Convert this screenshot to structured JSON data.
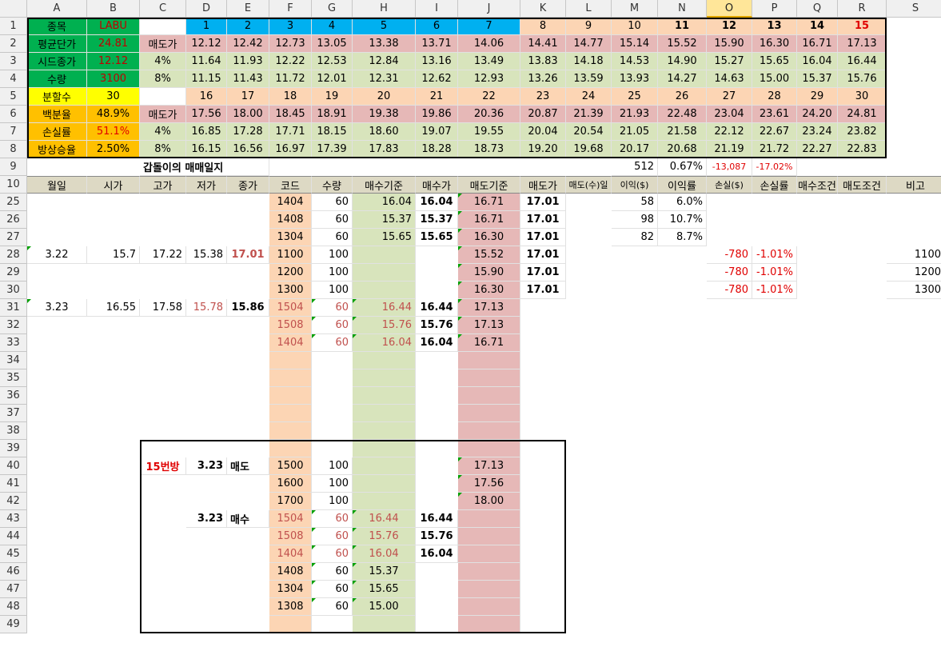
{
  "columns": [
    "A",
    "B",
    "C",
    "D",
    "E",
    "F",
    "G",
    "H",
    "I",
    "J",
    "K",
    "L",
    "M",
    "N",
    "O",
    "P",
    "Q",
    "R",
    "S"
  ],
  "selected_column": "O",
  "rows": [
    "1",
    "2",
    "3",
    "4",
    "5",
    "6",
    "7",
    "8",
    "9",
    "10",
    "25",
    "26",
    "27",
    "28",
    "29",
    "30",
    "31",
    "32",
    "33",
    "34",
    "35",
    "36",
    "37",
    "38",
    "39",
    "40",
    "41",
    "42",
    "43",
    "44",
    "45",
    "46",
    "47",
    "48",
    "49"
  ],
  "colors": {
    "green": "#00b050",
    "yellow": "#ffff00",
    "orange": "#ffc000",
    "blue": "#00b0f0",
    "peach": "#fcd5b4",
    "pink": "#e6b8b7",
    "lightgreen": "#d8e4bc",
    "header": "#ddd9c4"
  },
  "top": {
    "r1": {
      "a": "종목",
      "b": "LABU",
      "nums": [
        "1",
        "2",
        "3",
        "4",
        "5",
        "6",
        "7",
        "8",
        "9",
        "10",
        "11",
        "12",
        "13",
        "14",
        "15"
      ]
    },
    "r2": {
      "a": "평균단가",
      "b": "24.81",
      "c": "매도가",
      "vals": [
        "12.12",
        "12.42",
        "12.73",
        "13.05",
        "13.38",
        "13.71",
        "14.06",
        "14.41",
        "14.77",
        "15.14",
        "15.52",
        "15.90",
        "16.30",
        "16.71",
        "17.13"
      ]
    },
    "r3": {
      "a": "시드종가",
      "b": "12.12",
      "c": "4%",
      "vals": [
        "11.64",
        "11.93",
        "12.22",
        "12.53",
        "12.84",
        "13.16",
        "13.49",
        "13.83",
        "14.18",
        "14.53",
        "14.90",
        "15.27",
        "15.65",
        "16.04",
        "16.44"
      ]
    },
    "r4": {
      "a": "수량",
      "b": "3100",
      "c": "8%",
      "vals": [
        "11.15",
        "11.43",
        "11.72",
        "12.01",
        "12.31",
        "12.62",
        "12.93",
        "13.26",
        "13.59",
        "13.93",
        "14.27",
        "14.63",
        "15.00",
        "15.37",
        "15.76"
      ]
    },
    "r5": {
      "a": "분할수",
      "b": "30",
      "nums": [
        "16",
        "17",
        "18",
        "19",
        "20",
        "21",
        "22",
        "23",
        "24",
        "25",
        "26",
        "27",
        "28",
        "29",
        "30"
      ]
    },
    "r6": {
      "a": "백분율",
      "b": "48.9%",
      "c": "매도가",
      "vals": [
        "17.56",
        "18.00",
        "18.45",
        "18.91",
        "19.38",
        "19.86",
        "20.36",
        "20.87",
        "21.39",
        "21.93",
        "22.48",
        "23.04",
        "23.61",
        "24.20",
        "24.81"
      ]
    },
    "r7": {
      "a": "손실률",
      "b": "51.1%",
      "c": "4%",
      "vals": [
        "16.85",
        "17.28",
        "17.71",
        "18.15",
        "18.60",
        "19.07",
        "19.55",
        "20.04",
        "20.54",
        "21.05",
        "21.58",
        "22.12",
        "22.67",
        "23.24",
        "23.82"
      ]
    },
    "r8": {
      "a": "방상승율",
      "b": "2.50%",
      "c": "8%",
      "vals": [
        "16.15",
        "16.56",
        "16.97",
        "17.39",
        "17.83",
        "18.28",
        "18.73",
        "19.20",
        "19.68",
        "20.17",
        "20.68",
        "21.19",
        "21.72",
        "22.27",
        "22.83"
      ]
    },
    "r9": {
      "title": "갑돌이의 매매일지",
      "m": "512",
      "n": "0.67%",
      "o": "-13,087",
      "p": "-17.02%"
    }
  },
  "headers": [
    "월일",
    "시가",
    "고가",
    "저가",
    "종가",
    "코드",
    "수량",
    "매수기준",
    "매수가",
    "매도기준",
    "매도가",
    "매도(수)일",
    "이익($)",
    "이익률",
    "손실($)",
    "손실률",
    "매수조건",
    "매도조건",
    "비고"
  ],
  "journal": [
    {
      "f": "1404",
      "g": "60",
      "h": "16.04",
      "i": "16.04",
      "j": "16.71",
      "k": "17.01",
      "m": "58",
      "n": "6.0%"
    },
    {
      "f": "1408",
      "g": "60",
      "h": "15.37",
      "i": "15.37",
      "j": "16.71",
      "k": "17.01",
      "m": "98",
      "n": "10.7%"
    },
    {
      "f": "1304",
      "g": "60",
      "h": "15.65",
      "i": "15.65",
      "j": "16.30",
      "k": "17.01",
      "m": "82",
      "n": "8.7%"
    },
    {
      "a": "3.22",
      "b": "15.7",
      "c": "17.22",
      "d": "15.38",
      "e": "17.01",
      "f": "1100",
      "g": "100",
      "j": "15.52",
      "k": "17.01",
      "o": "-780",
      "p": "-1.01%",
      "s": "1100"
    },
    {
      "f": "1200",
      "g": "100",
      "j": "15.90",
      "k": "17.01",
      "o": "-780",
      "p": "-1.01%",
      "s": "1200"
    },
    {
      "f": "1300",
      "g": "100",
      "j": "16.30",
      "k": "17.01",
      "o": "-780",
      "p": "-1.01%",
      "s": "1300"
    },
    {
      "a": "3.23",
      "b": "16.55",
      "c": "17.58",
      "d": "15.78",
      "e": "15.86",
      "f": "1504",
      "g": "60",
      "h": "16.44",
      "i": "16.44",
      "j": "17.13"
    },
    {
      "f": "1508",
      "g": "60",
      "h": "15.76",
      "i": "15.76",
      "j": "17.13"
    },
    {
      "f": "1404",
      "g": "60",
      "h": "16.04",
      "i": "16.04",
      "j": "16.71"
    }
  ],
  "room": {
    "label": "15번방",
    "sell_date": "3.23",
    "sell_label": "매도",
    "buy_date": "3.23",
    "buy_label": "매수",
    "sells": [
      {
        "f": "1500",
        "g": "100",
        "j": "17.13"
      },
      {
        "f": "1600",
        "g": "100",
        "j": "17.56"
      },
      {
        "f": "1700",
        "g": "100",
        "j": "18.00"
      }
    ],
    "buys": [
      {
        "f": "1504",
        "g": "60",
        "h": "16.44",
        "i": "16.44"
      },
      {
        "f": "1508",
        "g": "60",
        "h": "15.76",
        "i": "15.76"
      },
      {
        "f": "1404",
        "g": "60",
        "h": "16.04",
        "i": "16.04"
      },
      {
        "f": "1408",
        "g": "60",
        "h": "15.37"
      },
      {
        "f": "1304",
        "g": "60",
        "h": "15.65"
      },
      {
        "f": "1308",
        "g": "60",
        "h": "15.00"
      }
    ]
  }
}
